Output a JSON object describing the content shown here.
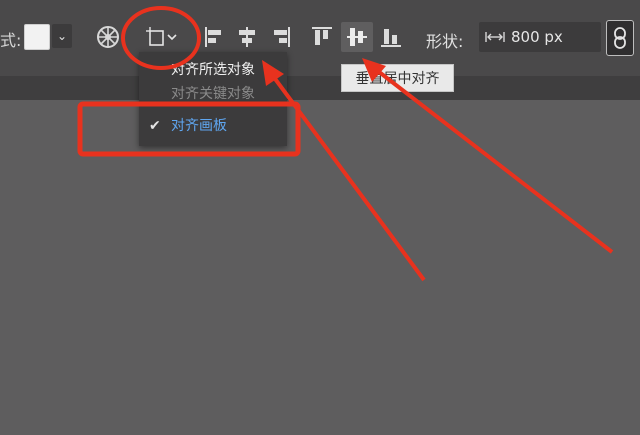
{
  "toolbar": {
    "style_label": "式:",
    "shape_label": "形状:",
    "width_value": "800 px"
  },
  "align_menu": {
    "items": [
      {
        "label": "对齐所选对象",
        "state": "normal"
      },
      {
        "label": "对齐关键对象",
        "state": "disabled"
      },
      {
        "label": "对齐画板",
        "state": "checked"
      }
    ],
    "check_glyph": "✔"
  },
  "tooltip": {
    "text": "垂直居中对齐"
  },
  "icons": [
    "fill-swatch",
    "chevron-down-icon",
    "gear-wheel-icon",
    "align-to-dropdown-icon",
    "align-left-icon",
    "align-horizontal-center-icon",
    "align-right-icon",
    "align-top-icon",
    "align-vertical-center-icon",
    "align-bottom-icon",
    "width-arrows-icon",
    "link-icon"
  ],
  "colors": {
    "toolbar_bg": "#4a494a",
    "canvas_bg": "#5e5d5e",
    "menu_bg": "#3c3b3c",
    "menu_checked_text": "#5fa6f0",
    "annotation_red": "#e8321e"
  }
}
